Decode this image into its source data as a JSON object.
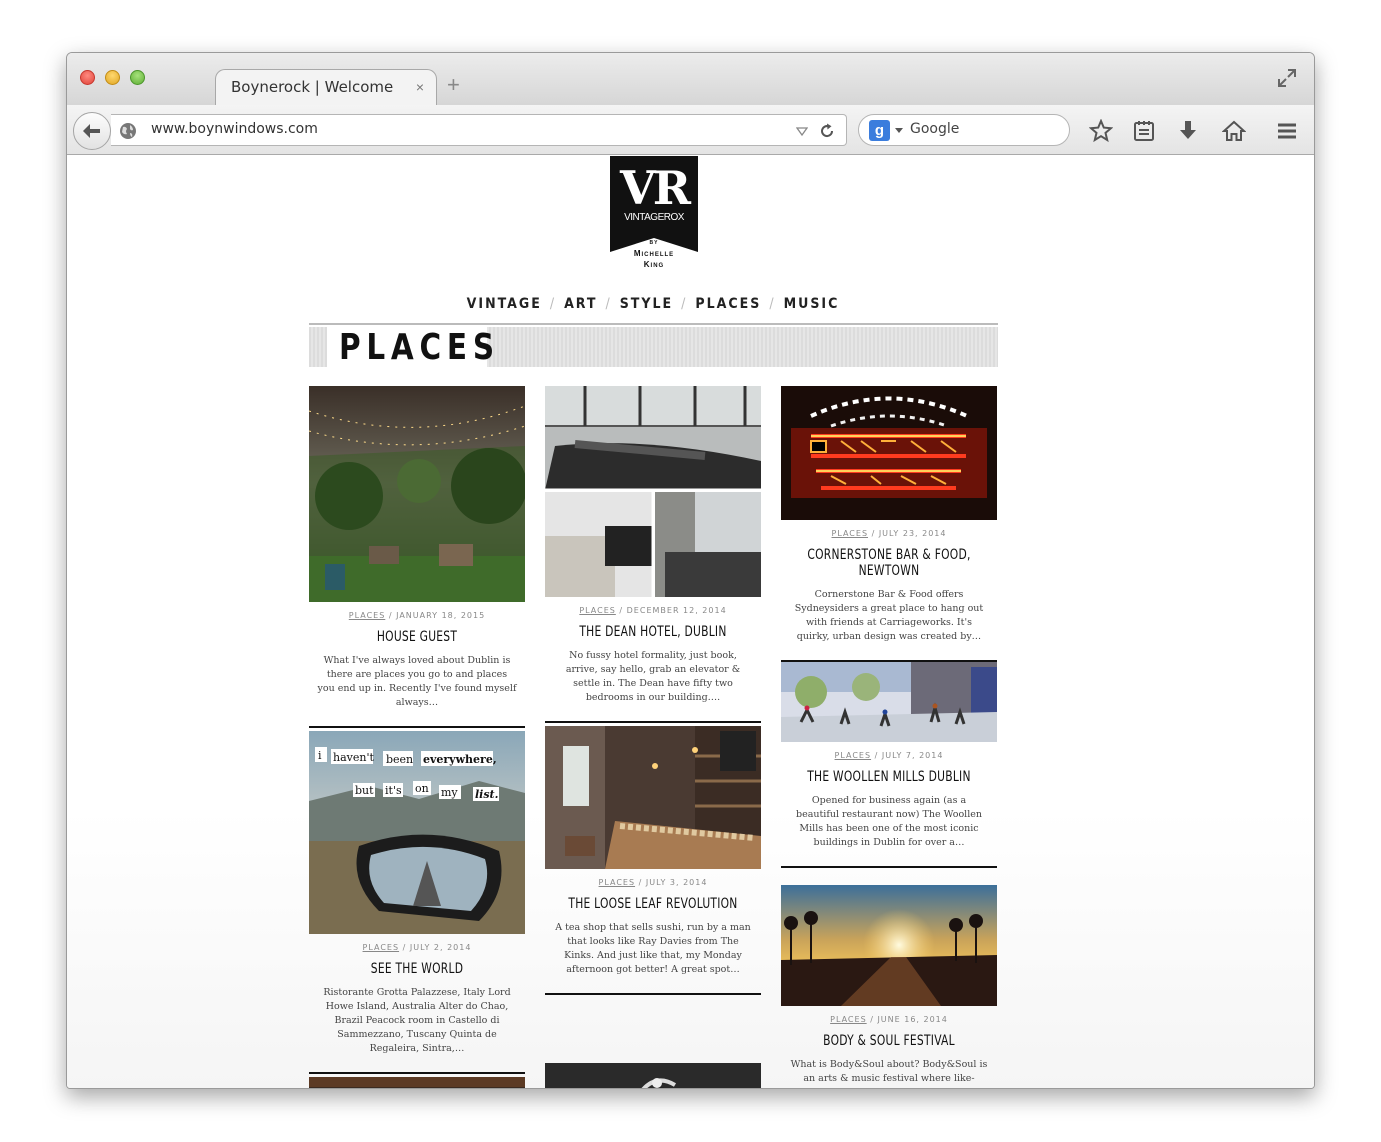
{
  "browser": {
    "tab_title": "Boynerock | Welcome",
    "tab_close": "×",
    "new_tab": "+",
    "url": "www.boynwindows.com",
    "search_engine_letter": "g",
    "search_placeholder": "Google"
  },
  "site": {
    "logo_letters": "VR",
    "logo_name": "VINTAGEROX",
    "logo_by": "BY",
    "logo_author_line1": "Michelle",
    "logo_author_line2": "King",
    "nav": [
      "VINTAGE",
      "ART",
      "STYLE",
      "PLACES",
      "MUSIC"
    ],
    "nav_separator": "/",
    "section_title": "PLACES"
  },
  "posts": [
    {
      "category": "PLACES",
      "date": "JANUARY 18, 2015",
      "title": "HOUSE GUEST",
      "excerpt": "What I've always loved about Dublin is there are places you go to and places you end up in. Recently I've found myself always…"
    },
    {
      "category": "PLACES",
      "date": "DECEMBER 12, 2014",
      "title": "THE DEAN HOTEL, DUBLIN",
      "excerpt": "No fussy hotel formality, just book, arrive, say hello, grab an elevator & settle in. The Dean have fifty two bedrooms in our building…."
    },
    {
      "category": "PLACES",
      "date": "JULY 23, 2014",
      "title": "CORNERSTONE BAR & FOOD, NEWTOWN",
      "excerpt": "Cornerstone Bar & Food offers Sydneysiders a great place to hang out with friends at Carriageworks.  It's quirky, urban design was created by…"
    },
    {
      "category": "PLACES",
      "date": "JULY 2, 2014",
      "title": "SEE THE WORLD",
      "excerpt": "Ristorante Grotta Palazzese, Italy Lord Howe Island, Australia Alter do Chao, Brazil Peacock room in Castello di Sammezzano, Tuscany Quinta de Regaleira, Sintra,…",
      "image_words": [
        "i",
        "haven't",
        "been",
        "everywhere,",
        "but",
        "it's",
        "on",
        "my",
        "list."
      ]
    },
    {
      "category": "PLACES",
      "date": "JULY 3, 2014",
      "title": "THE LOOSE LEAF REVOLUTION",
      "excerpt": "A tea shop that sells sushi, run by a man that looks like Ray Davies from The Kinks. And just like that, my Monday afternoon got better! A great spot…"
    },
    {
      "category": "PLACES",
      "date": "JULY 7, 2014",
      "title": "THE WOOLLEN MILLS DUBLIN",
      "excerpt": "Opened for business again (as a beautiful restaurant now) The Woollen Mills has been one of the most iconic buildings in Dublin for over a…"
    },
    {
      "category": "PLACES",
      "date": "JUNE 16, 2014",
      "title": "BODY & SOUL FESTIVAL",
      "excerpt": "What is Body&Soul about? Body&Soul is an arts & music festival where like-minded people"
    }
  ],
  "meta_separator": "/",
  "colors": {
    "neon": "#ff3b1f",
    "logo_bg": "#111111",
    "accent_rule": "#111111"
  }
}
